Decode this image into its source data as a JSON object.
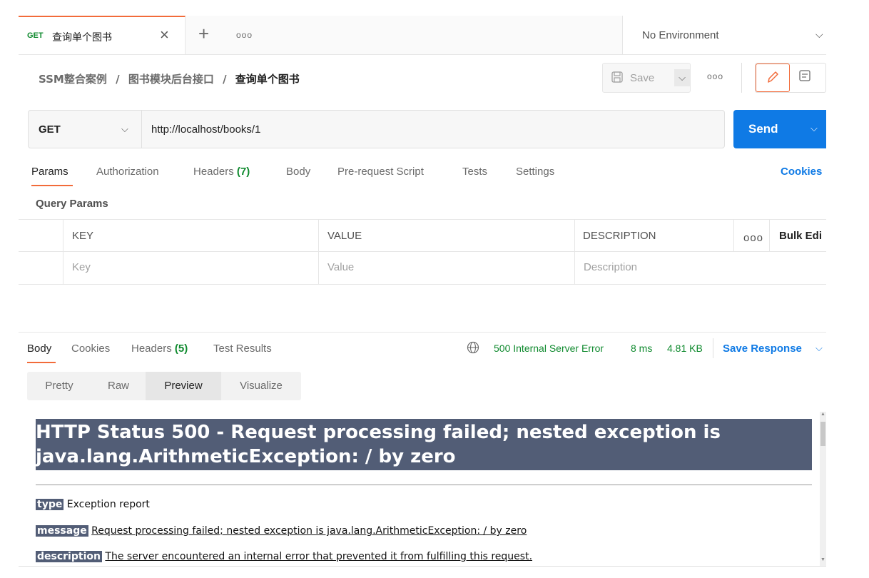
{
  "tabbar": {
    "active_tab": {
      "method": "GET",
      "name": "查询单个图书",
      "close": "✕"
    },
    "new_tab": "+",
    "more": "ooo",
    "environment": "No Environment",
    "environment_chevron": "⌄"
  },
  "breadcrumb": {
    "items": [
      "SSM整合案例",
      "图书模块后台接口",
      "查询单个图书"
    ],
    "separator": "/"
  },
  "toolbar": {
    "save_label": "Save",
    "more": "ooo",
    "icons": {
      "save": "floppy-icon",
      "edit": "pencil-icon",
      "docs": "document-icon"
    }
  },
  "request": {
    "method": "GET",
    "url": "http://localhost/books/1",
    "send_label": "Send"
  },
  "request_tabs": {
    "params": "Params",
    "authorization": "Authorization",
    "headers": "Headers",
    "headers_count": "(7)",
    "body": "Body",
    "pre_request": "Pre-request Script",
    "tests": "Tests",
    "settings": "Settings",
    "cookies": "Cookies"
  },
  "query_params": {
    "title": "Query Params",
    "columns": {
      "key": "KEY",
      "value": "VALUE",
      "description": "DESCRIPTION"
    },
    "more": "ooo",
    "bulk_edit": "Bulk Edi",
    "placeholders": {
      "key": "Key",
      "value": "Value",
      "description": "Description"
    }
  },
  "response": {
    "tabs": {
      "body": "Body",
      "cookies": "Cookies",
      "headers": "Headers",
      "headers_count": "(5)",
      "test_results": "Test Results"
    },
    "status": "500 Internal Server Error",
    "time": "8 ms",
    "size": "4.81 KB",
    "save_response": "Save Response",
    "view_modes": [
      "Pretty",
      "Raw",
      "Preview",
      "Visualize"
    ],
    "selected_view": "Preview"
  },
  "preview": {
    "heading_line1": "HTTP Status 500 - Request processing failed; nested exception is",
    "heading_line2": "java.lang.ArithmeticException: / by zero",
    "type_label": "type",
    "type_text": "Exception report",
    "message_label": "message",
    "message_text": "Request processing failed; nested exception is java.lang.ArithmeticException: / by zero",
    "description_label": "description",
    "description_text": "The server encountered an internal error that prevented it from fulfilling this request."
  },
  "colors": {
    "accent_orange": "#f26b3a",
    "send_blue": "#0f7ae5",
    "status_green": "#0f8a2e",
    "tomcat_band": "#525d76"
  }
}
